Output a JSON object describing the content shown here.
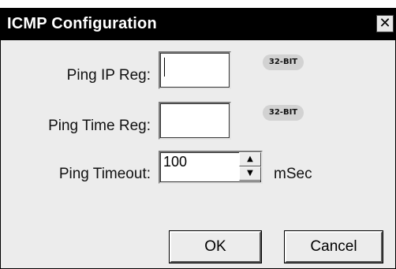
{
  "window": {
    "title": "ICMP Configuration",
    "close_glyph": "✕"
  },
  "fields": {
    "ping_ip_reg": {
      "label": "Ping IP Reg:",
      "value": "",
      "badge": "32-BIT"
    },
    "ping_time_reg": {
      "label": "Ping Time Reg:",
      "value": "",
      "badge": "32-BIT"
    },
    "ping_timeout": {
      "label": "Ping Timeout:",
      "value": "100",
      "unit": "mSec"
    }
  },
  "spinner": {
    "up_glyph": "▲",
    "down_glyph": "▼"
  },
  "buttons": {
    "ok": "OK",
    "cancel": "Cancel"
  },
  "icons": [
    "close-icon",
    "spin-up-icon",
    "spin-down-icon"
  ]
}
